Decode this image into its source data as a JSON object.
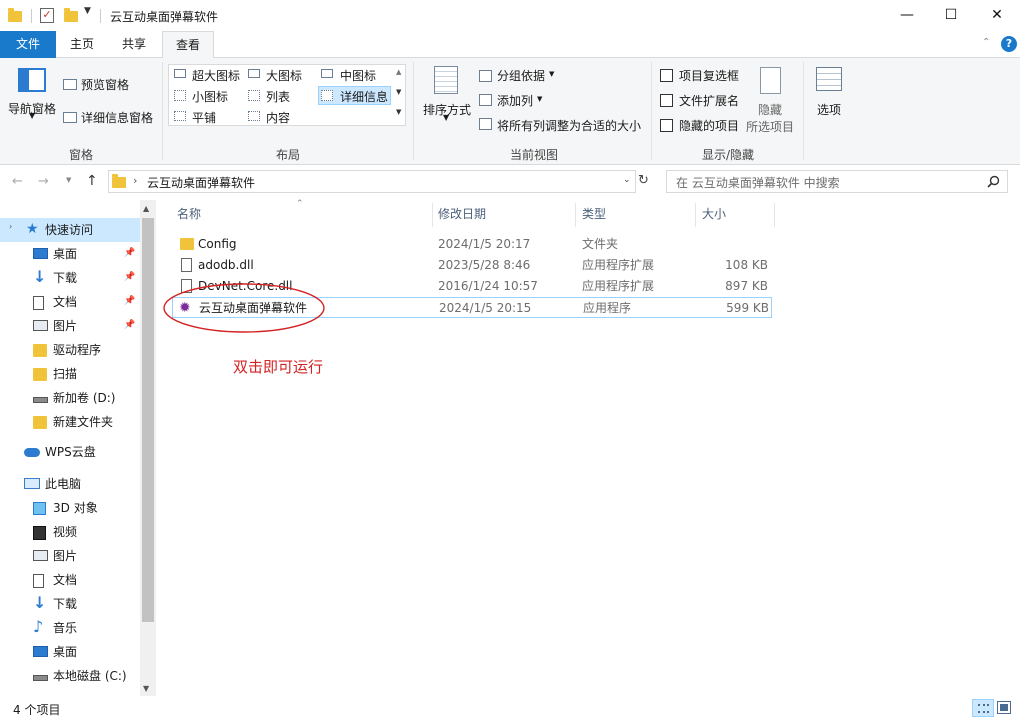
{
  "window": {
    "title": "云互动桌面弹幕软件",
    "minimize_glyph": "—",
    "maximize_glyph": "☐",
    "close_glyph": "✕"
  },
  "ribbon_tabs": [
    {
      "label": "文件"
    },
    {
      "label": "主页"
    },
    {
      "label": "共享"
    },
    {
      "label": "查看"
    }
  ],
  "ribbon": {
    "pane_group": {
      "nav_pane": "导航窗格",
      "preview_pane": "预览窗格",
      "details_pane": "详细信息窗格",
      "label": "窗格"
    },
    "layout_group": {
      "items": [
        "超大图标",
        "大图标",
        "中图标",
        "小图标",
        "列表",
        "详细信息",
        "平铺",
        "内容"
      ],
      "label": "布局"
    },
    "current_view_group": {
      "sort_by": "排序方式",
      "group_by": "分组依据",
      "add_column": "添加列",
      "size_all_columns": "将所有列调整为合适的大小",
      "label": "当前视图"
    },
    "show_hide_group": {
      "item_checkboxes": "项目复选框",
      "file_extensions": "文件扩展名",
      "hidden_items": "隐藏的项目",
      "hide_selected_1": "隐藏",
      "hide_selected_2": "所选项目",
      "label": "显示/隐藏"
    },
    "options": "选项"
  },
  "address": {
    "path": "云互动桌面弹幕软件",
    "search_placeholder": "在 云互动桌面弹幕软件 中搜索"
  },
  "nav_pane": {
    "quick_access": "快速访问",
    "items": [
      {
        "label": "桌面",
        "icon": "desktop-icon",
        "pinned": true
      },
      {
        "label": "下载",
        "icon": "download-icon",
        "pinned": true
      },
      {
        "label": "文档",
        "icon": "document-icon",
        "pinned": true
      },
      {
        "label": "图片",
        "icon": "picture-icon",
        "pinned": true
      },
      {
        "label": "驱动程序",
        "icon": "folder-icon",
        "pinned": false
      },
      {
        "label": "扫描",
        "icon": "folder-icon",
        "pinned": false
      },
      {
        "label": "新加卷 (D:)",
        "icon": "drive-icon",
        "pinned": false
      },
      {
        "label": "新建文件夹",
        "icon": "folder-icon",
        "pinned": false
      }
    ],
    "wps": "WPS云盘",
    "this_pc": "此电脑",
    "pc_items": [
      {
        "label": "3D 对象",
        "icon": "3d-objects-icon"
      },
      {
        "label": "视频",
        "icon": "video-icon"
      },
      {
        "label": "图片",
        "icon": "picture-icon"
      },
      {
        "label": "文档",
        "icon": "document-icon"
      },
      {
        "label": "下载",
        "icon": "download-icon"
      },
      {
        "label": "音乐",
        "icon": "music-icon"
      },
      {
        "label": "桌面",
        "icon": "desktop-icon"
      },
      {
        "label": "本地磁盘 (C:)",
        "icon": "drive-icon"
      }
    ]
  },
  "columns": {
    "name": "名称",
    "date": "修改日期",
    "type": "类型",
    "size": "大小"
  },
  "files": [
    {
      "name": "Config",
      "date": "2024/1/5 20:17",
      "type": "文件夹",
      "size": "",
      "icon": "folder-icon"
    },
    {
      "name": "adodb.dll",
      "date": "2023/5/28 8:46",
      "type": "应用程序扩展",
      "size": "108 KB",
      "icon": "dll-icon"
    },
    {
      "name": "DevNet.Core.dll",
      "date": "2016/1/24 10:57",
      "type": "应用程序扩展",
      "size": "897 KB",
      "icon": "dll-icon"
    },
    {
      "name": "云互动桌面弹幕软件",
      "date": "2024/1/5 20:15",
      "type": "应用程序",
      "size": "599 KB",
      "icon": "app-icon"
    }
  ],
  "annotation": {
    "text": "双击即可运行",
    "color": "#d42222"
  },
  "status": {
    "item_count": "4 个项目"
  },
  "colors": {
    "accent": "#1979ca",
    "selection_border": "#99d1ff",
    "folder": "#f0c33a"
  }
}
